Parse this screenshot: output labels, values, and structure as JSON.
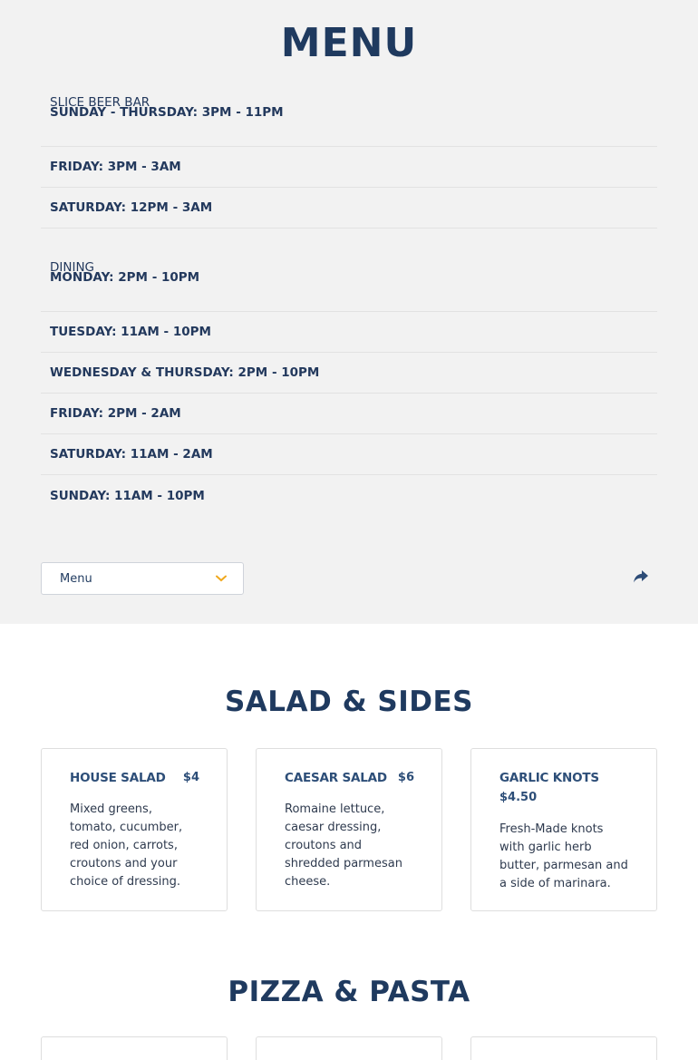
{
  "page_title": "MENU",
  "hours": {
    "beer_bar": {
      "title": "SLICE BEER BAR",
      "rows": [
        "SUNDAY - THURSDAY: 3PM - 11PM",
        "FRIDAY: 3PM - 3AM",
        "SATURDAY: 12PM - 3AM"
      ]
    },
    "dining": {
      "title": "DINING",
      "rows": [
        "MONDAY: 2PM - 10PM",
        "TUESDAY: 11AM - 10PM",
        "WEDNESDAY & THURSDAY: 2PM - 10PM",
        "FRIDAY: 2PM - 2AM",
        "SATURDAY: 11AM - 2AM",
        "SUNDAY: 11AM - 10PM"
      ]
    }
  },
  "controls": {
    "menu_select_value": "Menu",
    "chevron_icon": "chevron-down-icon",
    "share_icon": "share-icon"
  },
  "sections": {
    "salad": {
      "title": "SALAD & SIDES",
      "items": [
        {
          "name": "HOUSE SALAD",
          "price": "$4",
          "desc": "Mixed greens, tomato, cucumber, red onion, carrots, croutons and your choice of dressing."
        },
        {
          "name": "CAESAR SALAD",
          "price": "$6",
          "desc": "Romaine lettuce, caesar dressing, croutons and shredded parmesan cheese."
        },
        {
          "name": "GARLIC KNOTS",
          "price": "$4.50",
          "desc": "Fresh-Made knots with garlic herb butter, parmesan and a side of marinara."
        }
      ]
    },
    "pizza": {
      "title": "PIZZA & PASTA"
    }
  },
  "colors": {
    "heading": "#1f3a5f",
    "accent": "#f0a81c",
    "top_background": "#f2f2f2"
  }
}
